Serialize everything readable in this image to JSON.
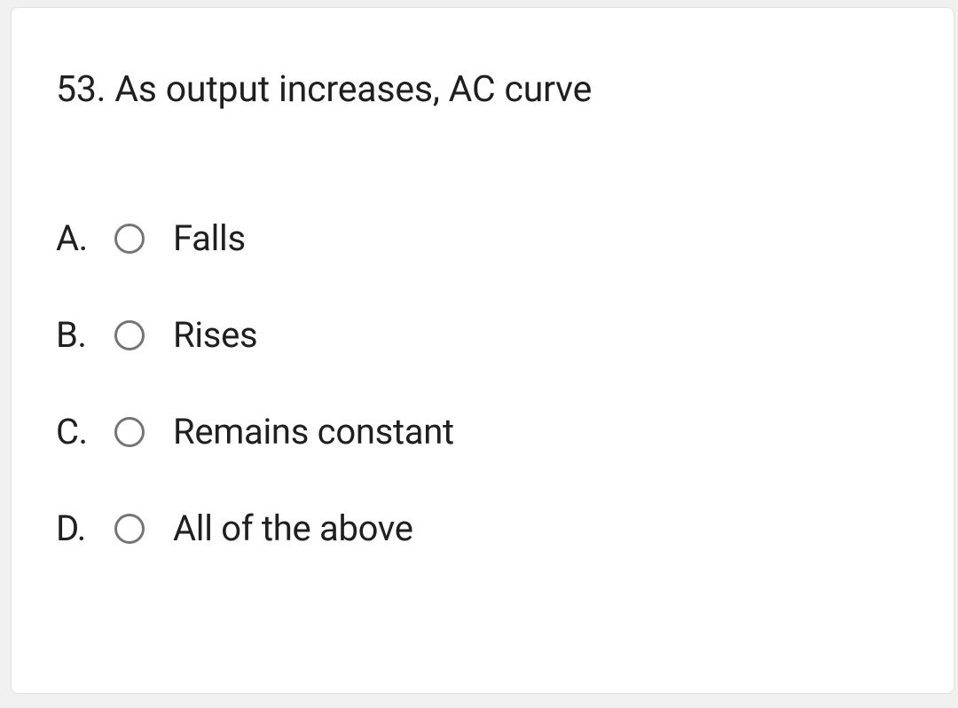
{
  "question": {
    "text": "53. As output increases, AC curve",
    "options": [
      {
        "letter": "A.",
        "label": "Falls"
      },
      {
        "letter": "B.",
        "label": "Rises"
      },
      {
        "letter": "C.",
        "label": "Remains constant"
      },
      {
        "letter": "D.",
        "label": "All of the above"
      }
    ]
  }
}
